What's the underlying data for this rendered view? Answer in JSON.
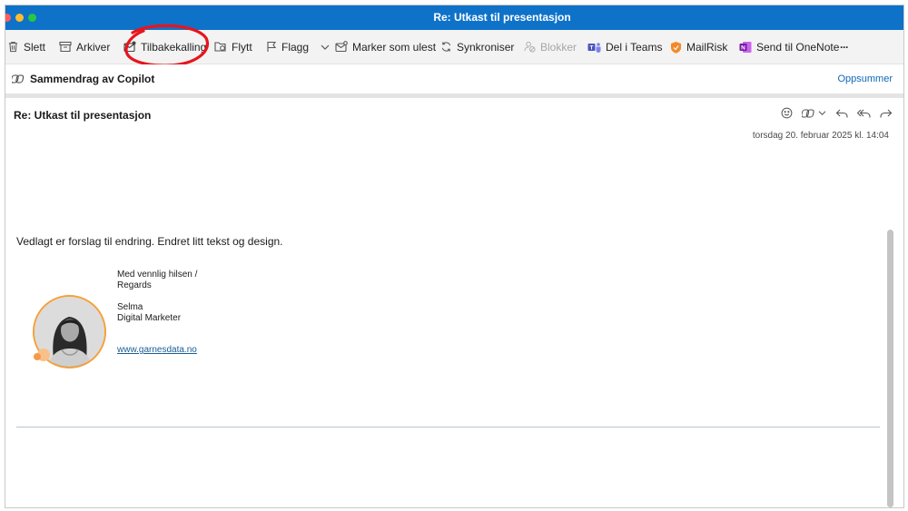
{
  "window": {
    "title": "Re: Utkast til presentasjon",
    "traffic_lights": [
      "#ff5f57",
      "#febc2e",
      "#28c840"
    ]
  },
  "toolbar": {
    "delete": "Slett",
    "archive": "Arkiver",
    "recall": "Tilbakekalling",
    "move": "Flytt",
    "flag": "Flagg",
    "mark_unread": "Marker som ulest",
    "sync": "Synkroniser",
    "block": "Blokker",
    "share_teams": "Del i Teams",
    "mailrisk": "MailRisk",
    "onenote": "Send til OneNote",
    "more": "···"
  },
  "copilot": {
    "label": "Sammendrag av Copilot",
    "action": "Oppsummer"
  },
  "message": {
    "subject": "Re: Utkast til presentasjon",
    "date": "torsdag 20. februar 2025 kl. 14:04",
    "body": "Vedlagt er forslag til endring. Endret litt tekst og design.",
    "signature": {
      "greeting_line1": "Med vennlig hilsen /",
      "greeting_line2": "Regards",
      "name": "Selma",
      "role": "Digital Marketer",
      "website": "www.garnesdata.no"
    }
  },
  "colors": {
    "titlebar": "#0f72c9",
    "toolbar_bg": "#f3f3f3",
    "annotation_red": "#e8141c",
    "link_blue": "#1068b8",
    "avatar_ring": "#f5a03a"
  }
}
